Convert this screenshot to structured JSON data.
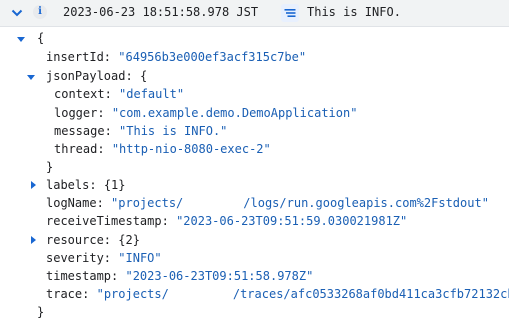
{
  "header": {
    "timestamp": "2023-06-23 18:51:58.978 JST",
    "message": "This is INFO.",
    "severity_icon": "info-icon",
    "summary_icon": "summary-lines-icon",
    "collapse_icon": "chevron-down-icon"
  },
  "colors": {
    "key": "#202124",
    "string_value": "#1a5fb4",
    "header_bg": "#f1f3f4",
    "info_blue": "#1967d2"
  },
  "log": {
    "open_brace": "{",
    "close_brace": "}",
    "insertId_key": "insertId:",
    "insertId_value": "\"64956b3e000ef3acf315c7be\"",
    "jsonPayload_key": "jsonPayload:",
    "jsonPayload_open": "{",
    "jsonPayload_close": "}",
    "jsonPayload_fields": [
      {
        "key": "context:",
        "value": "\"default\""
      },
      {
        "key": "logger:",
        "value": "\"com.example.demo.DemoApplication\""
      },
      {
        "key": "message:",
        "value": "\"This is INFO.\""
      },
      {
        "key": "thread:",
        "value": "\"http-nio-8080-exec-2\""
      }
    ],
    "labels_key": "labels:",
    "labels_summary": "{1}",
    "logName_key": "logName:",
    "logName_value_start": "\"projects/",
    "logName_value_end": "/logs/run.googleapis.com%2Fstdout\"",
    "receiveTimestamp_key": "receiveTimestamp:",
    "receiveTimestamp_value": "\"2023-06-23T09:51:59.030021981Z\"",
    "resource_key": "resource:",
    "resource_summary": "{2}",
    "severity_key": "severity:",
    "severity_value": "\"INFO\"",
    "timestamp_key": "timestamp:",
    "timestamp_value": "\"2023-06-23T09:51:58.978Z\"",
    "trace_key": "trace:",
    "trace_value_start": "\"projects/",
    "trace_value_end": "/traces/afc0533268af0bd411ca3cfb72132cb3\""
  }
}
